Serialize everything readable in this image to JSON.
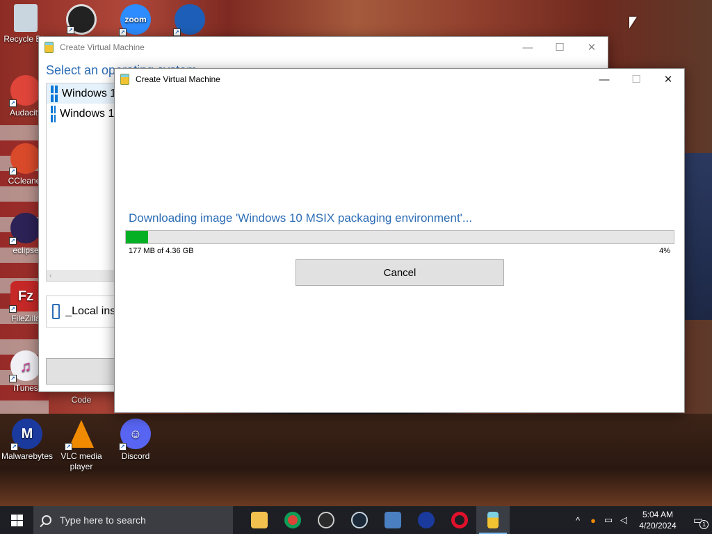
{
  "desktop": {
    "icons": [
      {
        "label": "Recycle Bin",
        "color": "#9fb6c8"
      },
      {
        "label": "",
        "color": "#222222"
      },
      {
        "label": "",
        "color": "#2d8cff",
        "text": "zoom"
      },
      {
        "label": "",
        "color": "#1d5fb8"
      },
      {
        "label": "Audacity",
        "color": "#e0453a"
      },
      {
        "label": "CCleaner",
        "color": "#d94a2a"
      },
      {
        "label": "eclipse",
        "color": "#2c2255"
      },
      {
        "label": "FileZilla",
        "color": "#c62828",
        "text": "Fz"
      },
      {
        "label": "iTunes",
        "color": "#f0f0f5"
      },
      {
        "label": "Code",
        "color": ""
      },
      {
        "label": "Malwarebytes",
        "color": "#1b3a9e"
      },
      {
        "label": "VLC media player",
        "color": "#f08a00"
      },
      {
        "label": "Discord",
        "color": "#5865f2"
      }
    ]
  },
  "back_window": {
    "title": "Create Virtual Machine",
    "heading": "Select an operating system",
    "os_items": [
      "Windows 11 dev environment",
      "Windows 10 MSIX packaging environment"
    ],
    "local_item": "_Local installation source",
    "scroll_arrow": "‹"
  },
  "front_window": {
    "title": "Create Virtual Machine",
    "status": "Downloading image 'Windows 10 MSIX packaging environment'...",
    "progress_fraction": 0.04,
    "size_text": "177 MB of 4.36 GB",
    "percent_text": "4%",
    "cancel_label": "Cancel",
    "minimize_glyph": "—",
    "maximize_glyph": "☐",
    "close_glyph": "✕"
  },
  "taskbar": {
    "search_placeholder": "Type here to search",
    "apps": [
      {
        "name": "file-explorer",
        "color": "#f2c14e"
      },
      {
        "name": "chrome",
        "color": "#db4437"
      },
      {
        "name": "obs",
        "color": "#2b2b2b"
      },
      {
        "name": "steam",
        "color": "#1b2838"
      },
      {
        "name": "remote-desktop",
        "color": "#4a7fc1"
      },
      {
        "name": "malwarebytes",
        "color": "#1b3a9e"
      },
      {
        "name": "opera",
        "color": "#e0112b"
      },
      {
        "name": "hyper-v-quick-create",
        "color": "#7ed0e3"
      }
    ],
    "tray": {
      "chevron": "^",
      "time": "5:04 AM",
      "date": "4/20/2024",
      "notification_count": "1"
    }
  },
  "colors": {
    "accent_blue": "#2d6db5",
    "progress_green": "#06b025",
    "taskbar_bg": "#1d1f24"
  }
}
